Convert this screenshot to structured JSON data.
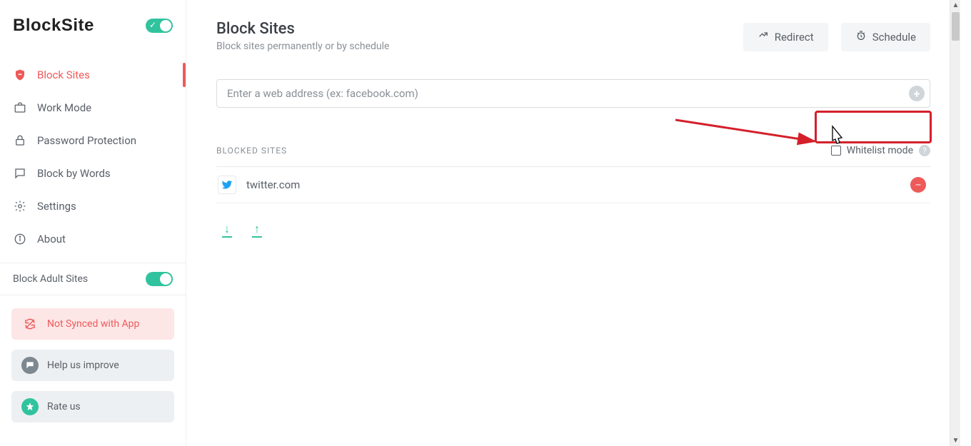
{
  "brand": "BlockSite",
  "sidebar": {
    "items": [
      {
        "label": "Block Sites"
      },
      {
        "label": "Work Mode"
      },
      {
        "label": "Password Protection"
      },
      {
        "label": "Block by Words"
      },
      {
        "label": "Settings"
      },
      {
        "label": "About"
      }
    ],
    "adult_label": "Block Adult Sites",
    "sync_label": "Not Synced with App",
    "improve_label": "Help us improve",
    "rate_label": "Rate us"
  },
  "main": {
    "title": "Block Sites",
    "subtitle": "Block sites permanently or by schedule",
    "redirect_label": "Redirect",
    "schedule_label": "Schedule",
    "input_placeholder": "Enter a web address (ex: facebook.com)",
    "section_label": "BLOCKED SITES",
    "whitelist_label": "Whitelist mode",
    "blocked": [
      {
        "domain": "twitter.com",
        "icon": "twitter"
      }
    ]
  }
}
